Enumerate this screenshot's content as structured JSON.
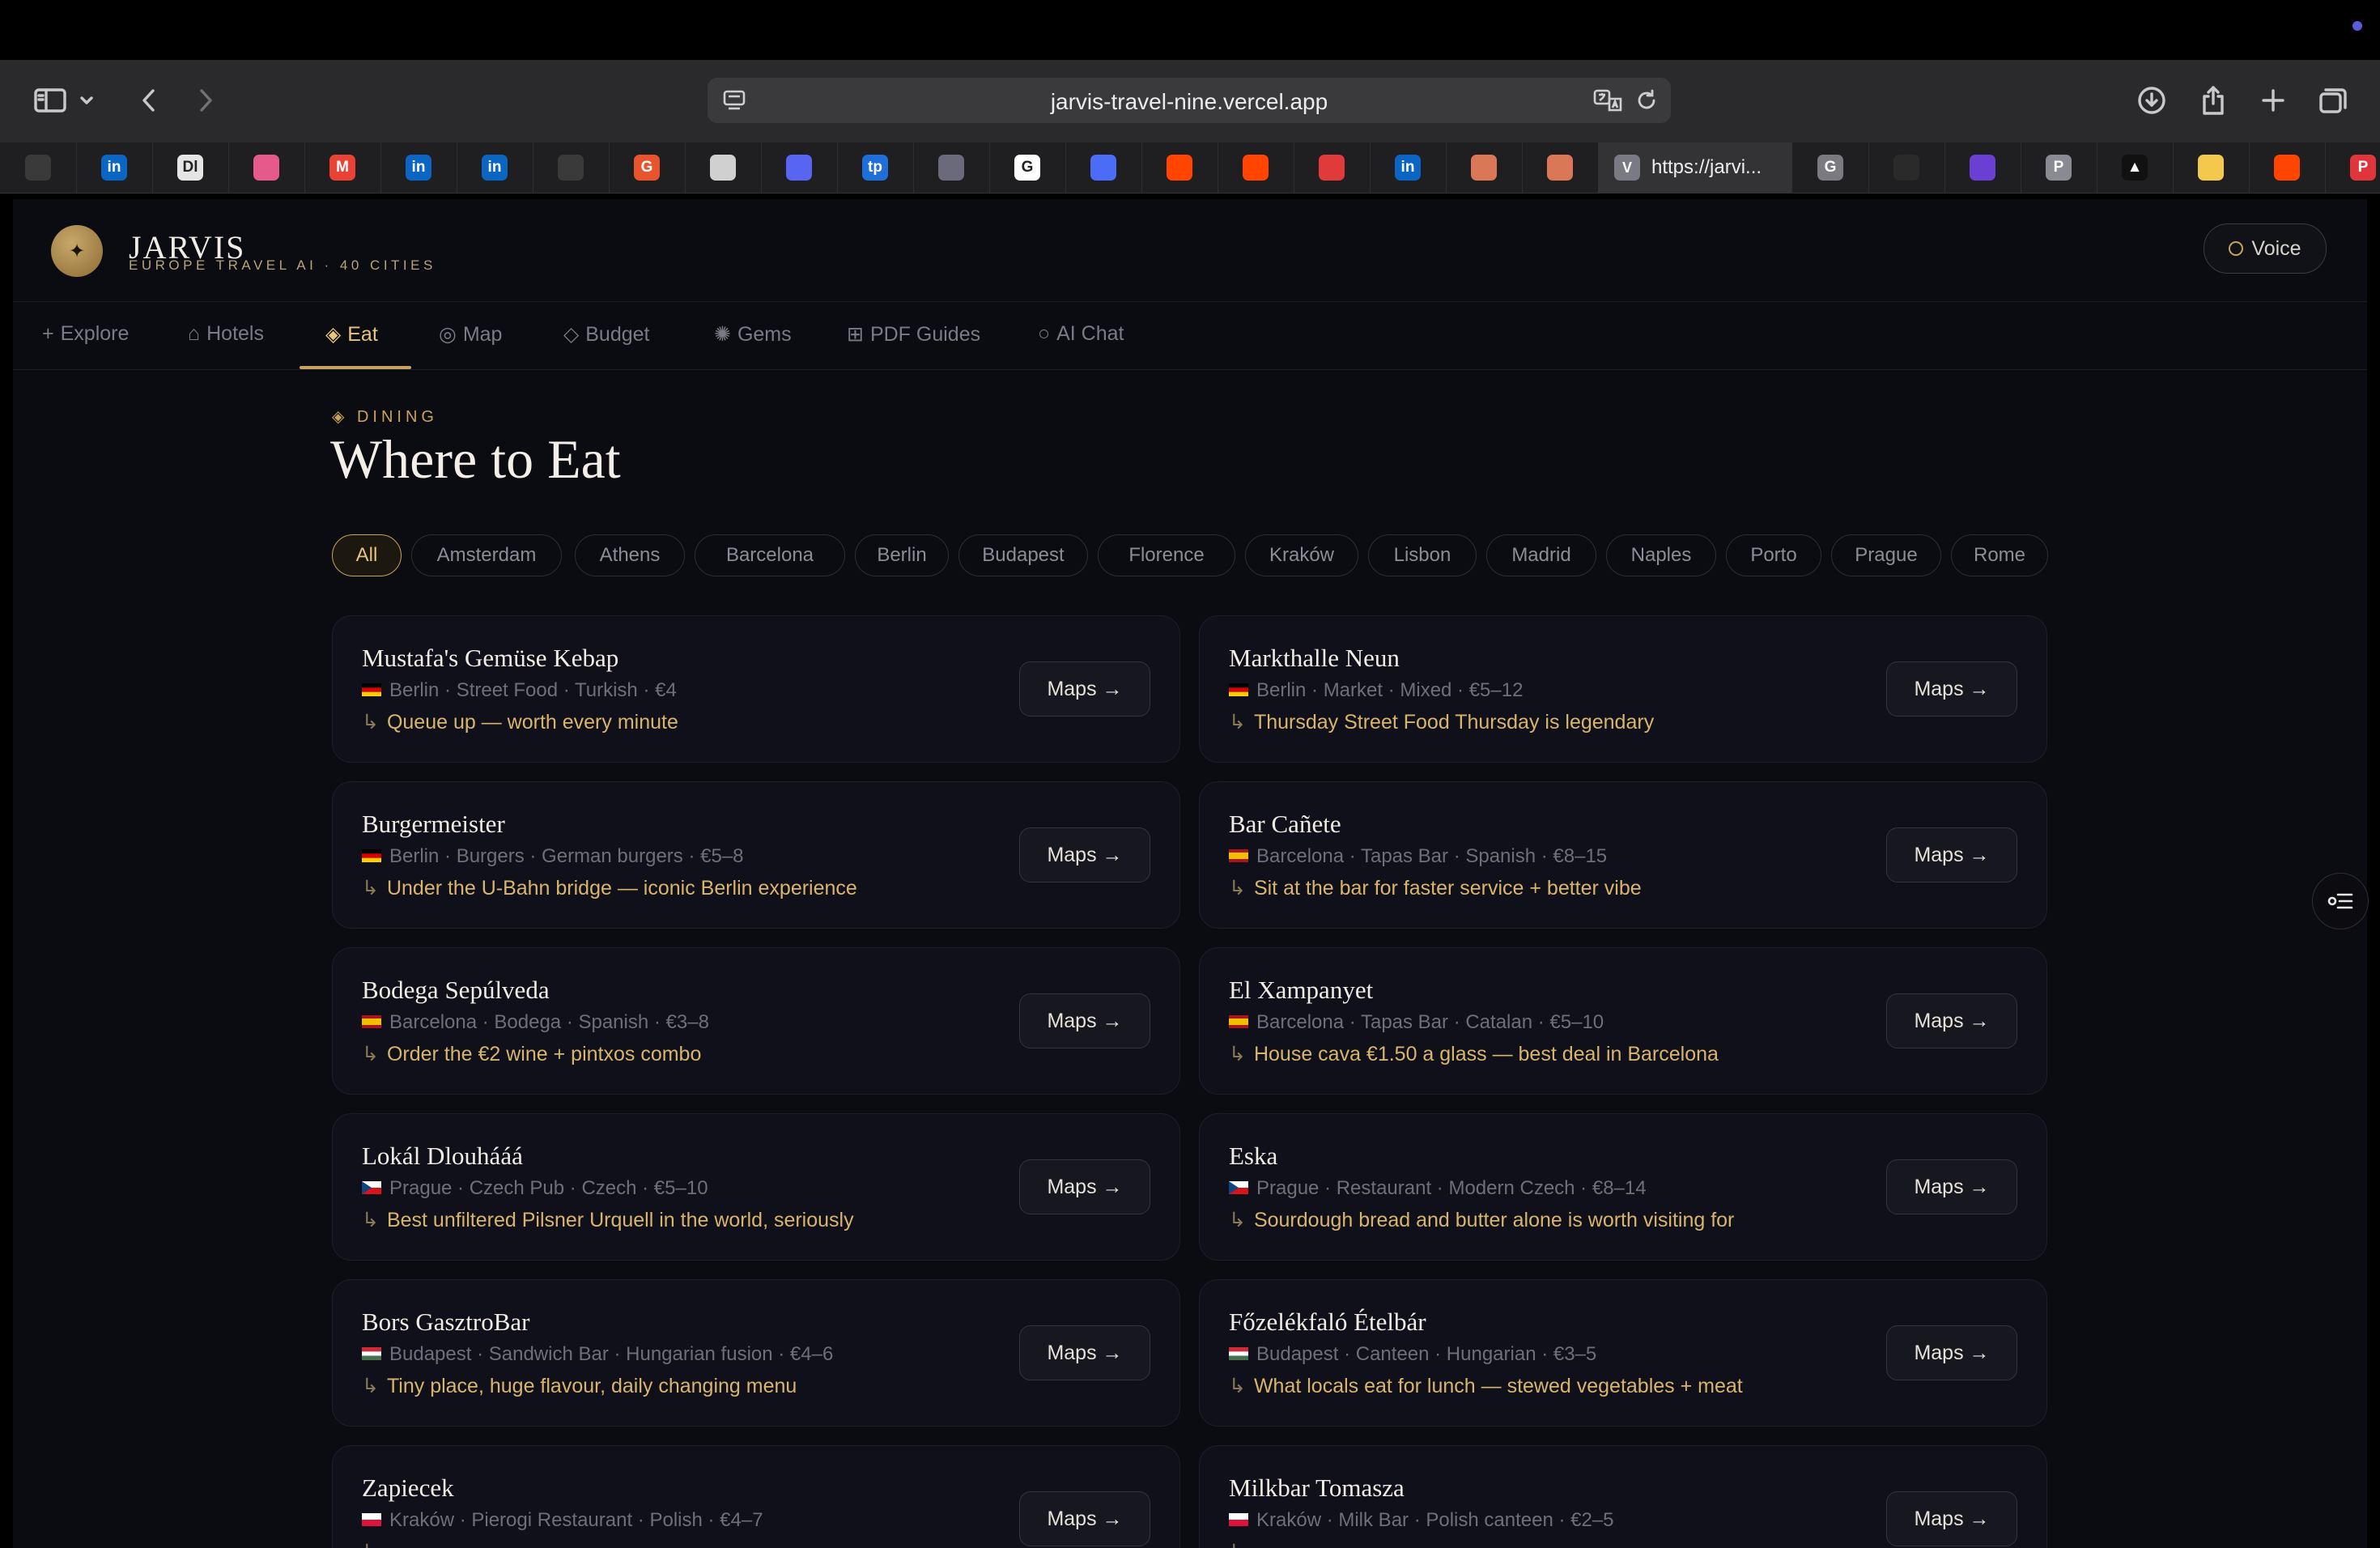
{
  "browser": {
    "url": "jarvis-travel-nine.vercel.app",
    "active_tab_title": "https://jarvi..."
  },
  "tabs": [
    {
      "icon": "openai-icon",
      "letter": "",
      "color": "#3a3a3a"
    },
    {
      "icon": "linkedin-icon",
      "letter": "in",
      "color": "#0a66c2"
    },
    {
      "icon": "dl-icon",
      "letter": "Dl",
      "color": "#e5e5e5"
    },
    {
      "icon": "bookmark-pink-icon",
      "letter": "",
      "color": "#e55a8a"
    },
    {
      "icon": "gmail-icon",
      "letter": "M",
      "color": "#ea4335"
    },
    {
      "icon": "linkedin-icon",
      "letter": "in",
      "color": "#0a66c2"
    },
    {
      "icon": "linkedin-icon",
      "letter": "in",
      "color": "#0a66c2"
    },
    {
      "icon": "openai-icon",
      "letter": "",
      "color": "#3a3a3a"
    },
    {
      "icon": "g-orange-icon",
      "letter": "G",
      "color": "#e8552d"
    },
    {
      "icon": "globe-icon",
      "letter": "",
      "color": "#d0d0d0"
    },
    {
      "icon": "discord-icon",
      "letter": "",
      "color": "#5865f2"
    },
    {
      "icon": "tp-icon",
      "letter": "tp",
      "color": "#1e6fd9"
    },
    {
      "icon": "cube-icon",
      "letter": "",
      "color": "#6a6a7a"
    },
    {
      "icon": "google-icon",
      "letter": "G",
      "color": "#ffffff"
    },
    {
      "icon": "chat-icon",
      "letter": "",
      "color": "#4a6cf7"
    },
    {
      "icon": "reddit-icon",
      "letter": "",
      "color": "#ff4500"
    },
    {
      "icon": "reddit-icon",
      "letter": "",
      "color": "#ff4500"
    },
    {
      "icon": "heart-icon",
      "letter": "",
      "color": "#e03a3a"
    },
    {
      "icon": "linkedin-icon",
      "letter": "in",
      "color": "#0a66c2"
    },
    {
      "icon": "claude-icon",
      "letter": "",
      "color": "#d97757"
    },
    {
      "icon": "claude-icon",
      "letter": "",
      "color": "#d97757"
    }
  ],
  "tabs_right": [
    {
      "icon": "g-gray-icon",
      "letter": "G",
      "color": "#7a7a80"
    },
    {
      "icon": "github-icon",
      "letter": "",
      "color": "#2a2a2a"
    },
    {
      "icon": "purple-app-icon",
      "letter": "",
      "color": "#6b3fd4"
    },
    {
      "icon": "p-gray-icon",
      "letter": "P",
      "color": "#8a8a94"
    },
    {
      "icon": "vercel-icon",
      "letter": "▲",
      "color": "#111111"
    },
    {
      "icon": "pencil-icon",
      "letter": "",
      "color": "#f2c94c"
    },
    {
      "icon": "reddit-icon",
      "letter": "",
      "color": "#ff4500"
    },
    {
      "icon": "p-red-icon",
      "letter": "P",
      "color": "#e0353b"
    }
  ],
  "app": {
    "title": "JARVIS",
    "subtitle": "EUROPE TRAVEL AI · 40 CITIES",
    "voice_label": "Voice",
    "nav": [
      {
        "glyph": "+",
        "label": "Explore"
      },
      {
        "glyph": "⌂",
        "label": "Hotels"
      },
      {
        "glyph": "◈",
        "label": "Eat"
      },
      {
        "glyph": "◎",
        "label": "Map"
      },
      {
        "glyph": "◇",
        "label": "Budget"
      },
      {
        "glyph": "✺",
        "label": "Gems"
      },
      {
        "glyph": "⊞",
        "label": "PDF Guides"
      },
      {
        "glyph": "○",
        "label": "AI Chat"
      }
    ],
    "active_nav": "Eat"
  },
  "section": {
    "label": "◈  DINING",
    "title": "Where to Eat"
  },
  "filters": [
    "All",
    "Amsterdam",
    "Athens",
    "Barcelona",
    "Berlin",
    "Budapest",
    "Florence",
    "Kraków",
    "Lisbon",
    "Madrid",
    "Naples",
    "Porto",
    "Prague",
    "Rome"
  ],
  "active_filter": "All",
  "maps_label": "Maps →",
  "tip_arrow": "↳",
  "restaurants": [
    {
      "name": "Mustafa's Gemüse Kebap",
      "flag": "de",
      "meta": "Berlin · Street Food · Turkish · €4",
      "tip": "Queue up — worth every minute"
    },
    {
      "name": "Markthalle Neun",
      "flag": "de",
      "meta": "Berlin · Market · Mixed · €5–12",
      "tip": "Thursday Street Food Thursday is legendary"
    },
    {
      "name": "Burgermeister",
      "flag": "de",
      "meta": "Berlin · Burgers · German burgers · €5–8",
      "tip": "Under the U-Bahn bridge — iconic Berlin experience"
    },
    {
      "name": "Bar Cañete",
      "flag": "es",
      "meta": "Barcelona · Tapas Bar · Spanish · €8–15",
      "tip": "Sit at the bar for faster service + better vibe"
    },
    {
      "name": "Bodega Sepúlveda",
      "flag": "es",
      "meta": "Barcelona · Bodega · Spanish · €3–8",
      "tip": "Order the €2 wine + pintxos combo"
    },
    {
      "name": "El Xampanyet",
      "flag": "es",
      "meta": "Barcelona · Tapas Bar · Catalan · €5–10",
      "tip": "House cava €1.50 a glass — best deal in Barcelona"
    },
    {
      "name": "Lokál Dlouhááá",
      "flag": "cz",
      "meta": "Prague · Czech Pub · Czech · €5–10",
      "tip": "Best unfiltered Pilsner Urquell in the world, seriously"
    },
    {
      "name": "Eska",
      "flag": "cz",
      "meta": "Prague · Restaurant · Modern Czech · €8–14",
      "tip": "Sourdough bread and butter alone is worth visiting for"
    },
    {
      "name": "Bors GasztroBar",
      "flag": "hu",
      "meta": "Budapest · Sandwich Bar · Hungarian fusion · €4–6",
      "tip": "Tiny place, huge flavour, daily changing menu"
    },
    {
      "name": "Főzelékfaló Ételbár",
      "flag": "hu",
      "meta": "Budapest · Canteen · Hungarian · €3–5",
      "tip": "What locals eat for lunch — stewed vegetables + meat"
    },
    {
      "name": "Zapiecek",
      "flag": "pl",
      "meta": "Kraków · Pierogi Restaurant · Polish · €4–7",
      "tip": ""
    },
    {
      "name": "Milkbar Tomasza",
      "flag": "pl",
      "meta": "Kraków · Milk Bar · Polish canteen · €2–5",
      "tip": ""
    }
  ]
}
